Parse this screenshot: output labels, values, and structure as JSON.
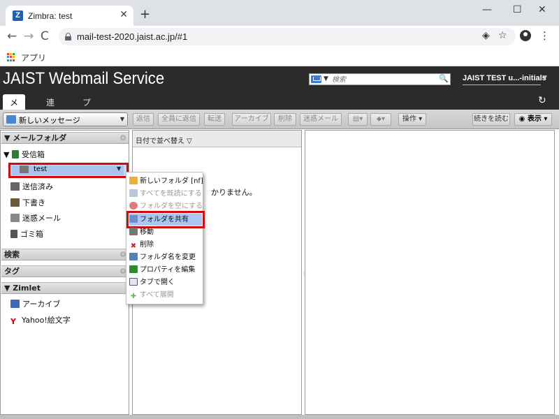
{
  "browser": {
    "tab_title": "Zimbra: test",
    "tab_favicon_letter": "Z",
    "new_tab_glyph": "+",
    "close_glyph": "✕",
    "url": "mail-test-2020.jaist.ac.jp/#1",
    "bookmarks_apps_label": "アプリ",
    "window_controls": {
      "minimize": "—",
      "maximize": "☐",
      "close": "✕"
    },
    "nav": {
      "back": "←",
      "forward": "→",
      "reload": "C"
    },
    "omnibox_icons": {
      "cast": "◈",
      "star": "☆"
    },
    "menu_glyph": "⋮"
  },
  "header": {
    "logo": "JAIST Webmail Service",
    "search_placeholder": "検索",
    "search_icon": "🔍",
    "user": "JAIST TEST u...-initials",
    "tabs": [
      "メール",
      "連絡先",
      "プリファレンス"
    ],
    "active_tab": "メール",
    "refresh_glyph": "↻"
  },
  "toolbar": {
    "new_message": "新しいメッセージ",
    "buttons": [
      "返信",
      "全員に返信",
      "転送",
      "アーカイブ",
      "削除",
      "迷惑メール",
      "操作",
      "続きを読む",
      "表示"
    ]
  },
  "sidebar": {
    "mail_folders_header": "メールフォルダ",
    "inbox": "受信箱",
    "selected_folder": "test",
    "folders": [
      "送信済み",
      "下書き",
      "迷惑メール",
      "ゴミ箱"
    ],
    "search_header": "検索",
    "tags_header": "タグ",
    "zimlet_header": "Zimlet",
    "zimlets": [
      "アーカイブ",
      "Yahoo!絵文字"
    ]
  },
  "list": {
    "sort_label": "日付で並べ替え ▽",
    "empty_text": "かりません。"
  },
  "context_menu": {
    "items": [
      {
        "label": "新しいフォルダ  [nf]",
        "enabled": true,
        "icon_color": "#e8b23a"
      },
      {
        "label": "すべてを既読にする",
        "enabled": false,
        "icon_color": "#b9c8d8"
      },
      {
        "label": "フォルダを空にする",
        "enabled": false,
        "icon_color": "#e57a7a"
      },
      {
        "label": "フォルダを共有",
        "enabled": true,
        "icon_color": "#6a8fc9",
        "highlighted": true
      },
      {
        "label": "移動",
        "enabled": true,
        "icon_color": "#777777"
      },
      {
        "label": "削除",
        "enabled": true,
        "icon_color": "#d32020"
      },
      {
        "label": "フォルダ名を変更",
        "enabled": true,
        "icon_color": "#5a7fb5"
      },
      {
        "label": "プロパティを編集",
        "enabled": true,
        "icon_color": "#2f8a2f"
      },
      {
        "label": "タブで開く",
        "enabled": true,
        "icon_color": "#dfe7f2"
      },
      {
        "label": "すべて展開",
        "enabled": false,
        "icon_color": "#66b866"
      }
    ]
  },
  "colors": {
    "header_bg": "#2b2b2b",
    "highlight_border": "#d10a0a",
    "selection_bg": "#a8c4ee"
  }
}
